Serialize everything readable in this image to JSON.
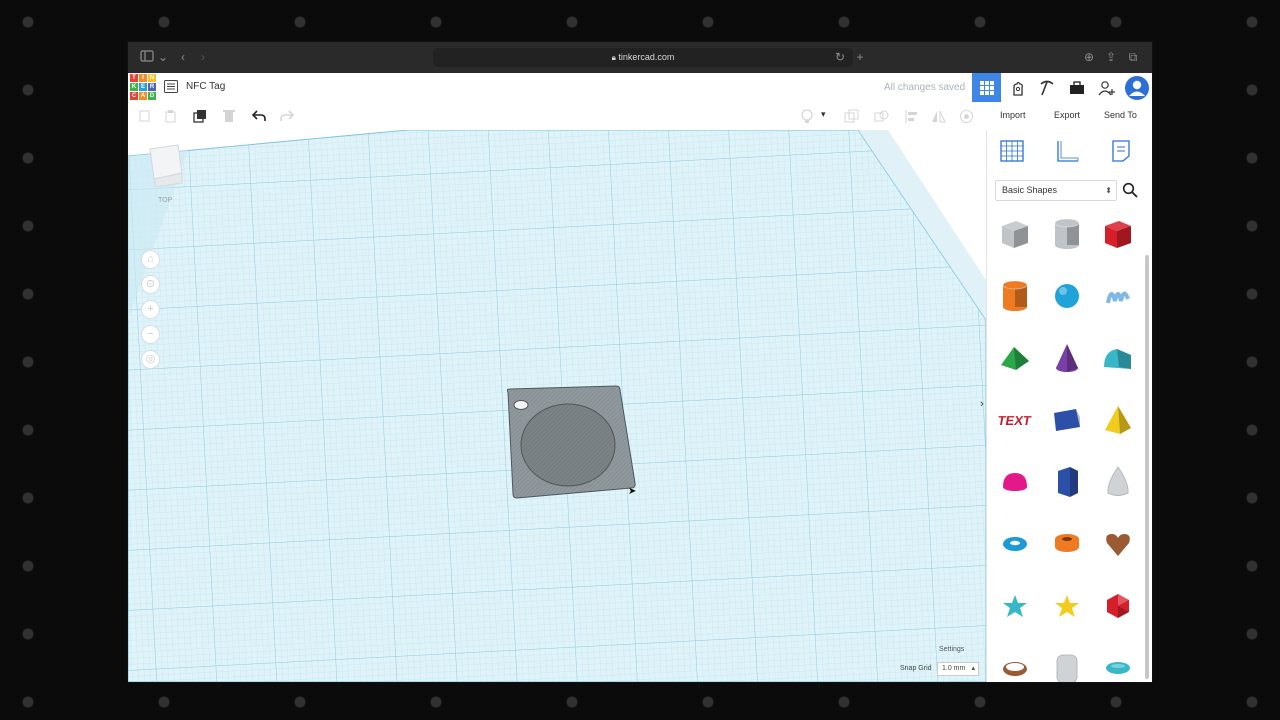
{
  "browser": {
    "url": "tinkercad.com"
  },
  "app": {
    "document_title": "NFC Tag",
    "save_status": "All changes saved",
    "logo_letters": [
      "T",
      "I",
      "N",
      "K",
      "E",
      "R",
      "C",
      "A",
      "D"
    ],
    "logo_colors": [
      "#e5423a",
      "#f18e2c",
      "#f5c02a",
      "#3fb24a",
      "#2a9fd8",
      "#4f64b0",
      "#e5423a",
      "#f18e2c",
      "#3fb24a"
    ]
  },
  "toolbar": {
    "import_label": "Import",
    "export_label": "Export",
    "send_to_label": "Send To"
  },
  "viewcube": {
    "top_label": "TOP"
  },
  "workplane": {
    "settings_label": "Settings",
    "snap_grid_label": "Snap Grid",
    "snap_grid_value": "1.0 mm"
  },
  "panel": {
    "category": "Basic Shapes",
    "shapes": [
      {
        "name": "box-hole",
        "color": "#bfc4c9"
      },
      {
        "name": "cylinder-hole",
        "color": "#bfc4c9"
      },
      {
        "name": "box",
        "color": "#d61f2b"
      },
      {
        "name": "cylinder",
        "color": "#ee7a22"
      },
      {
        "name": "sphere",
        "color": "#1fa3d8"
      },
      {
        "name": "scribble",
        "color": "#7fb8e6"
      },
      {
        "name": "roof",
        "color": "#2aa84a"
      },
      {
        "name": "cone",
        "color": "#7a3fa6"
      },
      {
        "name": "round-roof",
        "color": "#37b7c8"
      },
      {
        "name": "text",
        "color": "#c21f2b"
      },
      {
        "name": "wedge",
        "color": "#2c4fa8"
      },
      {
        "name": "pyramid",
        "color": "#f2cc1c"
      },
      {
        "name": "half-sphere",
        "color": "#e3198a"
      },
      {
        "name": "polygon",
        "color": "#2c4fa8"
      },
      {
        "name": "paraboloid",
        "color": "#cfd3d6"
      },
      {
        "name": "torus",
        "color": "#1c9ad6"
      },
      {
        "name": "tube",
        "color": "#ee7a22"
      },
      {
        "name": "heart",
        "color": "#9a5a34"
      },
      {
        "name": "star",
        "color": "#37b7c8"
      },
      {
        "name": "star-gold",
        "color": "#f2cc1c"
      },
      {
        "name": "icosahedron",
        "color": "#d61f2b"
      },
      {
        "name": "ring",
        "color": "#9a5a34"
      },
      {
        "name": "capsule",
        "color": "#cfd3d6"
      },
      {
        "name": "ellipsoid",
        "color": "#37b7c8"
      }
    ]
  },
  "colors": {
    "accent": "#3f87e6",
    "grid": "#a9d8e8",
    "plane": "#d7f0f8"
  }
}
